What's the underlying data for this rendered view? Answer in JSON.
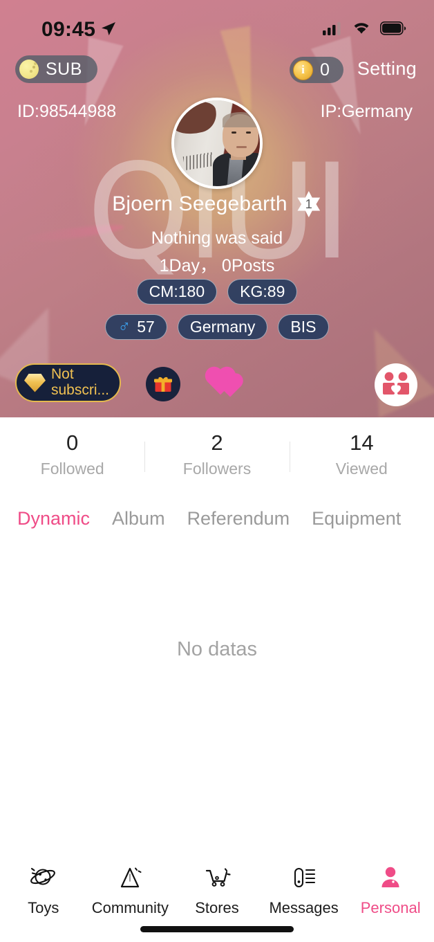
{
  "status_bar": {
    "time": "09:45",
    "location_icon": "location-arrow-icon",
    "signal_icon": "cellular-signal-icon",
    "wifi_icon": "wifi-icon",
    "battery_icon": "battery-icon"
  },
  "header": {
    "sub_badge": {
      "label": "SUB",
      "icon": "moon-icon"
    },
    "coin_badge": {
      "value": "0",
      "icon": "coin-icon",
      "coin_letter": "i"
    },
    "setting_label": "Setting",
    "id_text": "ID:98544988",
    "ip_text": "IP:Germany",
    "watermark_text": "QIUI",
    "avatar_alt": "user-avatar",
    "display_name": "Bjoern Seegebarth",
    "level": "1",
    "signature": "Nothing was said",
    "days_posts": "1Day， 0Posts",
    "chips_row1": [
      {
        "label": "CM:180"
      },
      {
        "label": "KG:89"
      }
    ],
    "chips_row2": [
      {
        "label": "57",
        "icon": "male-gender-icon",
        "glyph": "♂"
      },
      {
        "label": "Germany"
      },
      {
        "label": "BIS"
      }
    ],
    "actions": {
      "not_subscribed_label": "Not subscri...",
      "not_subscribed_icon": "diamond-icon",
      "gift_icon": "gift-icon",
      "gift_glyph": "🎁",
      "hearts_icon": "double-heart-icon",
      "couple_icon": "couple-heart-icon"
    },
    "colors": {
      "base": "#be7e86",
      "glow": "#d8b27e",
      "chip_bg": "#1c375c",
      "gold": "#f0c152",
      "navy": "#16203a"
    }
  },
  "stats": [
    {
      "value": "0",
      "label": "Followed"
    },
    {
      "value": "2",
      "label": "Followers"
    },
    {
      "value": "14",
      "label": "Viewed"
    }
  ],
  "tabs": [
    {
      "label": "Dynamic",
      "active": true
    },
    {
      "label": "Album",
      "active": false
    },
    {
      "label": "Referendum",
      "active": false
    },
    {
      "label": "Equipment",
      "active": false
    }
  ],
  "content": {
    "empty_text": "No datas"
  },
  "bottom_nav": {
    "accent_color": "#ef4c87",
    "items": [
      {
        "label": "Toys",
        "icon": "toy-planet-icon",
        "active": false
      },
      {
        "label": "Community",
        "icon": "triangle-icon",
        "active": false
      },
      {
        "label": "Stores",
        "icon": "shopping-cart-icon",
        "active": false
      },
      {
        "label": "Messages",
        "icon": "message-list-icon",
        "active": false
      },
      {
        "label": "Personal",
        "icon": "person-icon",
        "active": true
      }
    ]
  }
}
